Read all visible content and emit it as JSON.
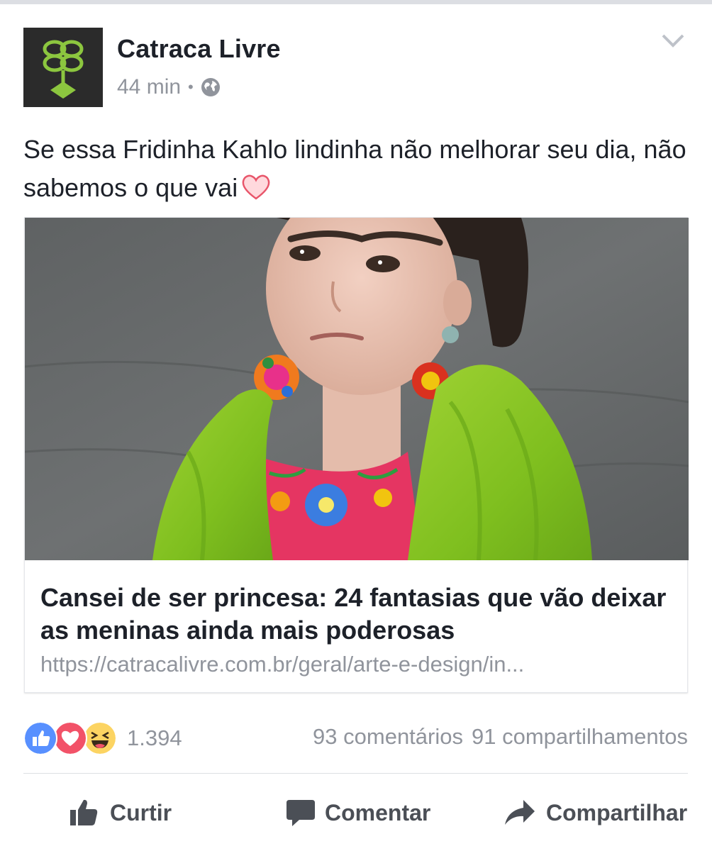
{
  "post": {
    "page_name": "Catraca Livre",
    "time": "44 min",
    "separator": "•",
    "text": "Se essa Fridinha Kahlo lindinha não melhorar seu dia, não sabemos o que vai",
    "avatar_icon": "catraca-livre-logo",
    "privacy_icon": "globe-icon",
    "menu_icon": "chevron-down-icon"
  },
  "link_card": {
    "image_description_icon": "photo",
    "title": "Cansei de ser princesa: 24 fantasias que vão deixar as meninas ainda mais poderosas",
    "url": "https://catracalivre.com.br/geral/arte-e-design/in..."
  },
  "engagement": {
    "reaction_icons": [
      "like-icon",
      "love-icon",
      "haha-icon"
    ],
    "reaction_count": "1.394",
    "comments": "93 comentários",
    "shares": "91 compartilhamentos"
  },
  "actions": {
    "like": "Curtir",
    "comment": "Comentar",
    "share": "Compartilhar"
  },
  "colors": {
    "text": "#1d2129",
    "muted": "#90949c",
    "like_blue": "#5890ff",
    "love_red": "#f25268",
    "haha_yellow": "#fcd462",
    "logo_green": "#8cc63f"
  }
}
